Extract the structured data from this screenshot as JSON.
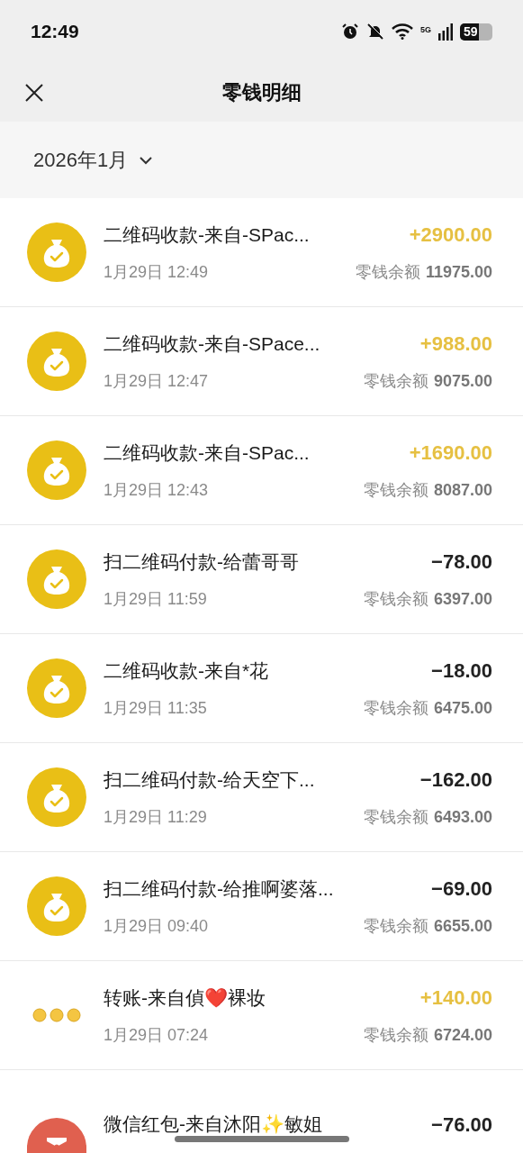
{
  "status_bar": {
    "time": "12:49",
    "network": "5G",
    "battery": "59"
  },
  "header": {
    "title": "零钱明细"
  },
  "month_filter": {
    "label": "2026年1月"
  },
  "transactions": [
    {
      "kind": "bag",
      "title": "二维码收款-来自-SPac...",
      "time": "1月29日 12:49",
      "amount": "+2900.00",
      "income": true,
      "balance_label": "零钱余额",
      "balance": "11975.00"
    },
    {
      "kind": "bag",
      "title": "二维码收款-来自-SPace...",
      "time": "1月29日 12:47",
      "amount": "+988.00",
      "income": true,
      "balance_label": "零钱余额",
      "balance": "9075.00"
    },
    {
      "kind": "bag",
      "title": "二维码收款-来自-SPac...",
      "time": "1月29日 12:43",
      "amount": "+1690.00",
      "income": true,
      "balance_label": "零钱余额",
      "balance": "8087.00"
    },
    {
      "kind": "bag",
      "title": "扫二维码付款-给蕾哥哥",
      "time": "1月29日 11:59",
      "amount": "−78.00",
      "income": false,
      "balance_label": "零钱余额",
      "balance": "6397.00"
    },
    {
      "kind": "bag",
      "title": "二维码收款-来自*花",
      "time": "1月29日 11:35",
      "amount": "−18.00",
      "income": false,
      "balance_label": "零钱余额",
      "balance": "6475.00"
    },
    {
      "kind": "bag",
      "title": "扫二维码付款-给天空下...",
      "time": "1月29日 11:29",
      "amount": "−162.00",
      "income": false,
      "balance_label": "零钱余额",
      "balance": "6493.00"
    },
    {
      "kind": "bag",
      "title": "扫二维码付款-给推啊婆落...",
      "time": "1月29日 09:40",
      "amount": "−69.00",
      "income": false,
      "balance_label": "零钱余额",
      "balance": "6655.00"
    },
    {
      "kind": "transfer",
      "title": "转账-来自偵❤️裸妆",
      "time": "1月29日 07:24",
      "amount": "+140.00",
      "income": true,
      "balance_label": "零钱余额",
      "balance": "6724.00"
    },
    {
      "kind": "envelope",
      "title": "微信红包-来自沐阳✨敏姐",
      "amount": "−76.00",
      "income": false
    }
  ]
}
